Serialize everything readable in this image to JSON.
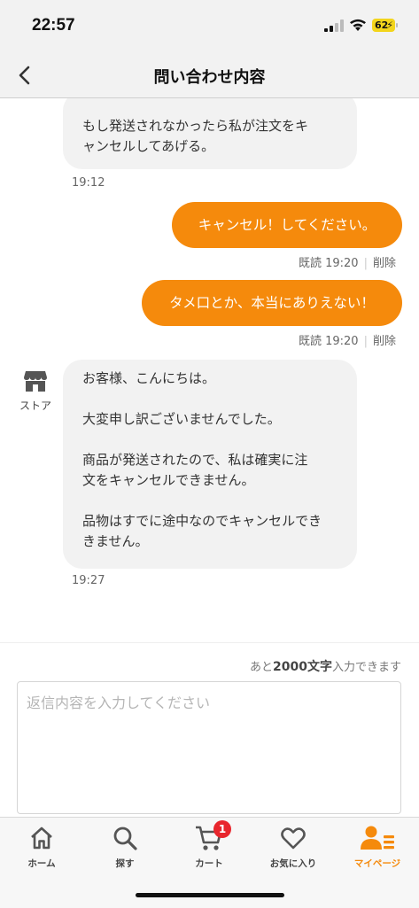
{
  "status_bar": {
    "time": "22:57",
    "battery": "62"
  },
  "header": {
    "title": "問い合わせ内容"
  },
  "messages": [
    {
      "lines": [
        "もし発送されなかったら私が注文をキ",
        "ャンセルしてあげる。"
      ],
      "time": "19:12"
    },
    {
      "text": "キャンセル！してください。",
      "read": "既読 19:20",
      "delete": "削除"
    },
    {
      "text": "タメ口とか、本当にありえない！",
      "read": "既読 19:20",
      "delete": "削除"
    },
    {
      "sender": "ストア",
      "paragraphs": [
        [
          "お客様、こんにちは。"
        ],
        [
          "大変申し訳ございませんでした。"
        ],
        [
          "商品が発送されたので、私は確実に注",
          "文をキャンセルできません。"
        ],
        [
          "品物はすでに途中なのでキャンセルでき",
          "きません。"
        ]
      ],
      "time": "19:27"
    }
  ],
  "reply": {
    "counter_prefix": "あと",
    "counter_num": "2000文字",
    "counter_suffix": "入力できます",
    "placeholder": "返信内容を入力してください"
  },
  "tabs": [
    {
      "label": "ホーム",
      "icon": "home-icon"
    },
    {
      "label": "探す",
      "icon": "search-icon"
    },
    {
      "label": "カート",
      "icon": "cart-icon",
      "badge": "1"
    },
    {
      "label": "お気に入り",
      "icon": "heart-icon"
    },
    {
      "label": "マイページ",
      "icon": "mypage-icon",
      "active": true
    }
  ],
  "colors": {
    "accent": "#f58a0c",
    "badge": "#e8262d",
    "bubble_in": "#f2f2f2"
  }
}
